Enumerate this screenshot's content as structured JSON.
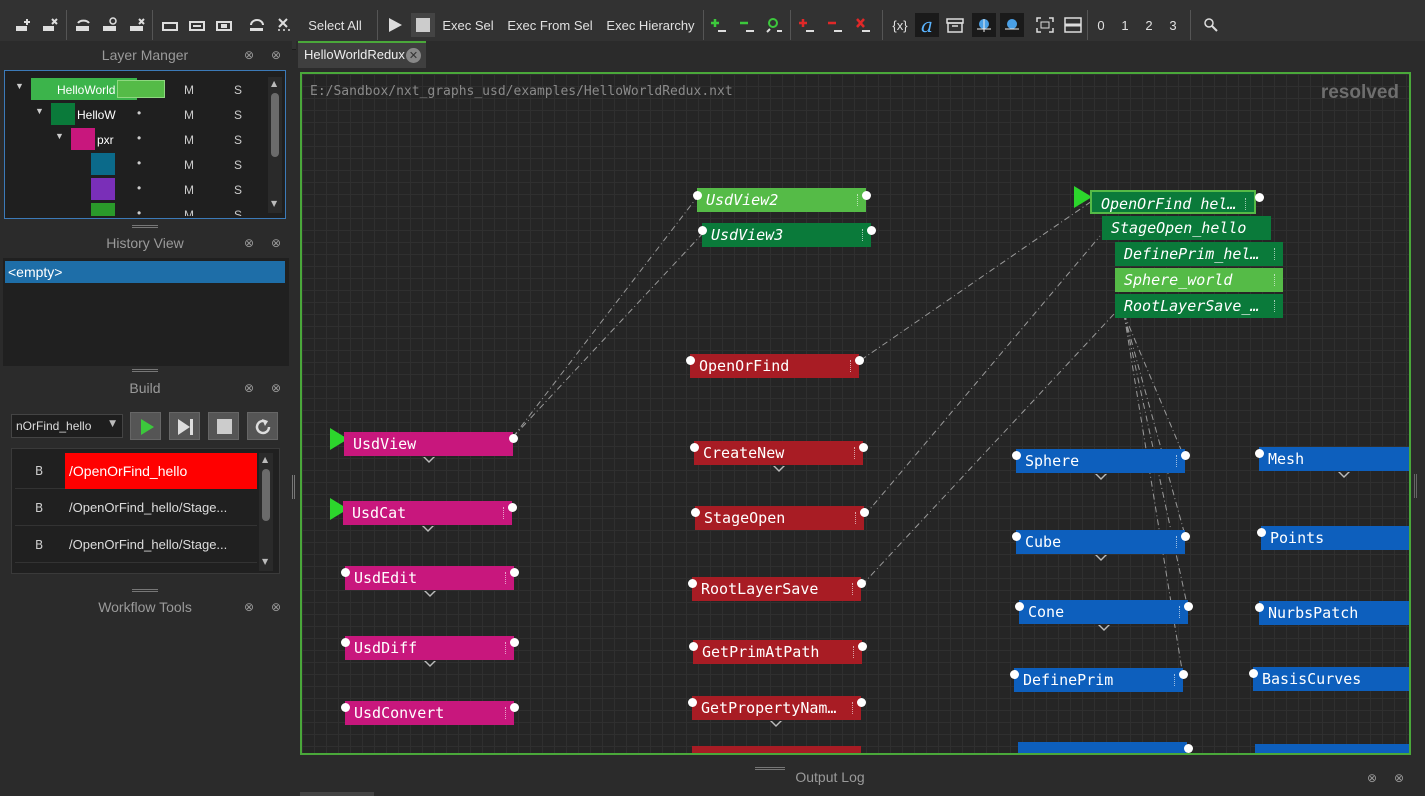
{
  "toolbar": {
    "select_all": "Select All",
    "exec_sel": "Exec Sel",
    "exec_from_sel": "Exec From Sel",
    "exec_hierarchy": "Exec Hierarchy",
    "levels": [
      "0",
      "1",
      "2",
      "3"
    ]
  },
  "layer_manager": {
    "title": "Layer Manger",
    "rows": [
      {
        "name": "HelloWorld",
        "m": "M",
        "s": "S",
        "color": "#3cb44b"
      },
      {
        "name": "HelloW",
        "m": "M",
        "s": "S",
        "color": "#0a7a3a"
      },
      {
        "name": "pxr",
        "m": "M",
        "s": "S",
        "color": "#c8177d"
      },
      {
        "name": "",
        "m": "M",
        "s": "S",
        "color": "#0b6a8a"
      },
      {
        "name": "",
        "m": "M",
        "s": "S",
        "color": "#7a2fb8"
      },
      {
        "name": "",
        "m": "M",
        "s": "S",
        "color": "#2a9a2a"
      }
    ]
  },
  "history": {
    "title": "History View",
    "items": [
      "<empty>"
    ]
  },
  "build": {
    "title": "Build",
    "dropdown_value": "nOrFind_hello",
    "rows": [
      {
        "flag": "B",
        "path": "/OpenOrFind_hello"
      },
      {
        "flag": "B",
        "path": "/OpenOrFind_hello/Stage..."
      },
      {
        "flag": "B",
        "path": "/OpenOrFind_hello/Stage..."
      }
    ]
  },
  "workflow": {
    "title": "Workflow Tools"
  },
  "output_log": {
    "title": "Output Log"
  },
  "tab": {
    "label": "HelloWorldRedux"
  },
  "graph": {
    "path": "E:/Sandbox/nxt_graphs_usd/examples/HelloWorldRedux.nxt",
    "mode": "resolved",
    "nodes": {
      "usdview2": "UsdView2",
      "usdview3": "UsdView3",
      "openorfind_hello": "OpenOrFind_hel…",
      "stageopen_hello": "StageOpen_hello",
      "defineprim_hello": "DefinePrim_hel…",
      "sphere_world": "Sphere_world",
      "rootlayersave_hello": "RootLayerSave_…",
      "openorfind": "OpenOrFind",
      "createnew": "CreateNew",
      "stageopen": "StageOpen",
      "rootlayersave": "RootLayerSave",
      "getprimatpath": "GetPrimAtPath",
      "getpropertynames": "GetPropertyNam…",
      "usdview": "UsdView",
      "usdcat": "UsdCat",
      "usdedit": "UsdEdit",
      "usddiff": "UsdDiff",
      "usdconvert": "UsdConvert",
      "sphere": "Sphere",
      "cube": "Cube",
      "cone": "Cone",
      "defineprim": "DefinePrim",
      "mesh": "Mesh",
      "points": "Points",
      "nurbspatch": "NurbsPatch",
      "basiscurves": "BasisCurves"
    }
  }
}
